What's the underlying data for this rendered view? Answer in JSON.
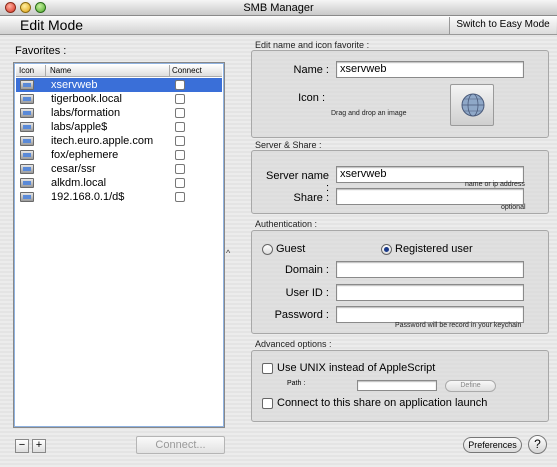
{
  "window": {
    "title": "SMB Manager"
  },
  "mode_bar": {
    "title": "Edit Mode",
    "switch_button": "Switch to Easy Mode"
  },
  "favorites": {
    "label": "Favorites :",
    "columns": [
      "Icon",
      "Name",
      "Connect"
    ],
    "items": [
      {
        "name": "xservweb",
        "selected": true
      },
      {
        "name": "tigerbook.local",
        "selected": false
      },
      {
        "name": "labs/formation",
        "selected": false
      },
      {
        "name": "labs/apple$",
        "selected": false
      },
      {
        "name": "itech.euro.apple.com",
        "selected": false
      },
      {
        "name": "fox/ephemere",
        "selected": false
      },
      {
        "name": "cesar/ssr",
        "selected": false
      },
      {
        "name": "alkdm.local",
        "selected": false
      },
      {
        "name": "192.168.0.1/d$",
        "selected": false
      }
    ],
    "remove_button": "−",
    "add_button": "+",
    "connect_button": "Connect...",
    "divider_glyph": "^"
  },
  "edit_section": {
    "label": "Edit name and icon favorite :",
    "name_label": "Name :",
    "name_value": "xservweb",
    "icon_label": "Icon :",
    "drag_hint": "Drag and drop an image"
  },
  "server_section": {
    "label": "Server & Share :",
    "server_label": "Server name :",
    "server_value": "xservweb",
    "server_hint": "name or ip address",
    "share_label": "Share :",
    "share_value": "",
    "share_hint": "optional"
  },
  "auth_section": {
    "label": "Authentication :",
    "guest_label": "Guest",
    "registered_label": "Registered user",
    "selected": "registered",
    "domain_label": "Domain :",
    "domain_value": "",
    "userid_label": "User ID :",
    "userid_value": "",
    "password_label": "Password :",
    "password_value": "",
    "password_hint": "Password will be record in your keychain"
  },
  "advanced_section": {
    "label": "Advanced options :",
    "unix_label": "Use UNIX instead of AppleScript",
    "unix_checked": false,
    "path_label": "Path :",
    "path_value": "",
    "define_button": "Define",
    "launch_label": "Connect to this share on application launch",
    "launch_checked": false
  },
  "footer": {
    "preferences_button": "Preferences",
    "help_button": "?"
  }
}
